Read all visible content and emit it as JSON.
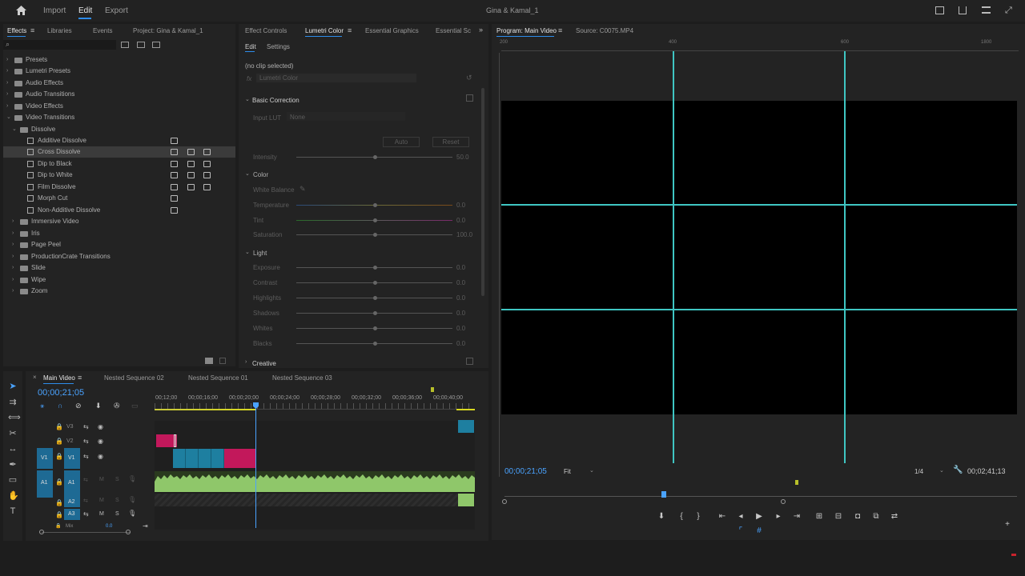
{
  "app": {
    "title": "Gina & Kamal_1"
  },
  "topbar": {
    "home_icon": "home-icon",
    "nav": [
      "Import",
      "Edit",
      "Export"
    ],
    "active": "Edit"
  },
  "effects_panel": {
    "tabs": [
      "Effects",
      "Libraries",
      "Events",
      "Project: Gina & Kamal_1"
    ],
    "search_placeholder": "",
    "tree": [
      {
        "label": "Presets",
        "level": 0,
        "type": "folder"
      },
      {
        "label": "Lumetri Presets",
        "level": 0,
        "type": "folder"
      },
      {
        "label": "Audio Effects",
        "level": 0,
        "type": "folder"
      },
      {
        "label": "Audio Transitions",
        "level": 0,
        "type": "folder"
      },
      {
        "label": "Video Effects",
        "level": 0,
        "type": "folder"
      },
      {
        "label": "Video Transitions",
        "level": 0,
        "type": "folder",
        "open": true
      },
      {
        "label": "Dissolve",
        "level": 1,
        "type": "folder",
        "open": true
      },
      {
        "label": "Additive Dissolve",
        "level": 2,
        "type": "item",
        "badges": 1
      },
      {
        "label": "Cross Dissolve",
        "level": 2,
        "type": "item",
        "badges": 3,
        "selected": true
      },
      {
        "label": "Dip to Black",
        "level": 2,
        "type": "item",
        "badges": 3
      },
      {
        "label": "Dip to White",
        "level": 2,
        "type": "item",
        "badges": 3
      },
      {
        "label": "Film Dissolve",
        "level": 2,
        "type": "item",
        "badges": 3
      },
      {
        "label": "Morph Cut",
        "level": 2,
        "type": "item",
        "badges": 1
      },
      {
        "label": "Non-Additive Dissolve",
        "level": 2,
        "type": "item",
        "badges": 1
      },
      {
        "label": "Immersive Video",
        "level": 1,
        "type": "folder"
      },
      {
        "label": "Iris",
        "level": 1,
        "type": "folder"
      },
      {
        "label": "Page Peel",
        "level": 1,
        "type": "folder"
      },
      {
        "label": "ProductionCrate Transitions",
        "level": 1,
        "type": "folder"
      },
      {
        "label": "Slide",
        "level": 1,
        "type": "folder"
      },
      {
        "label": "Wipe",
        "level": 1,
        "type": "folder"
      },
      {
        "label": "Zoom",
        "level": 1,
        "type": "folder"
      }
    ]
  },
  "lumetri": {
    "tabs": [
      "Effect Controls",
      "Lumetri Color",
      "Essential Graphics",
      "Essential Sc"
    ],
    "subtabs": [
      "Edit",
      "Settings"
    ],
    "no_clip": "(no clip selected)",
    "fx_value": "Lumetri Color",
    "basic_correction": "Basic Correction",
    "input_lut": "Input LUT",
    "input_lut_value": "None",
    "auto": "Auto",
    "reset": "Reset",
    "intensity": {
      "label": "Intensity",
      "value": "50.0"
    },
    "color_section": "Color",
    "white_balance": "White Balance",
    "color_sliders": [
      {
        "label": "Temperature",
        "value": "0.0"
      },
      {
        "label": "Tint",
        "value": "0.0"
      },
      {
        "label": "Saturation",
        "value": "100.0"
      }
    ],
    "light_section": "Light",
    "light_sliders": [
      {
        "label": "Exposure",
        "value": "0.0"
      },
      {
        "label": "Contrast",
        "value": "0.0"
      },
      {
        "label": "Highlights",
        "value": "0.0"
      },
      {
        "label": "Shadows",
        "value": "0.0"
      },
      {
        "label": "Whites",
        "value": "0.0"
      },
      {
        "label": "Blacks",
        "value": "0.0"
      }
    ],
    "creative": "Creative"
  },
  "program": {
    "tab": "Program: Main Video",
    "source": "Source: C0075.MP4",
    "ruler": [
      "200",
      "400",
      "600",
      "800",
      "1000",
      "1200",
      "1400",
      "1600",
      "1800"
    ],
    "timecode": "00;00;21;05",
    "fit": "Fit",
    "resolution": "1/4",
    "duration": "00;02;41;13"
  },
  "timeline": {
    "tabs": [
      "Main Video",
      "Nested Sequence 02",
      "Nested Sequence 01",
      "Nested Sequence 03"
    ],
    "timecode": "00;00;21;05",
    "ticks": [
      "00;12;00",
      "00;00;16;00",
      "00;00;20;00",
      "00;00;24;00",
      "00;00;28;00",
      "00;00;32;00",
      "00;00;36;00",
      "00;00;40;00"
    ],
    "tracks": [
      {
        "name": "V3"
      },
      {
        "name": "V2"
      },
      {
        "name": "V1",
        "source": "V1"
      },
      {
        "name": "A1",
        "source": "A1"
      },
      {
        "name": "A2"
      },
      {
        "name": "A3"
      }
    ],
    "mix": "Mix",
    "mix_value": "0.0",
    "track_buttons": {
      "mute": "M",
      "solo": "S"
    }
  },
  "colors": {
    "accent": "#2d8ceb",
    "guide": "#3fc6c3",
    "clip_pink": "#c2185b",
    "clip_blue": "#1e7fa0",
    "audio_green": "#8fc76a"
  }
}
